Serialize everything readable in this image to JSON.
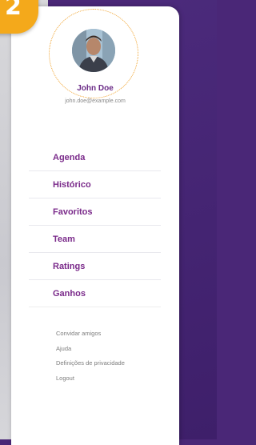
{
  "step": {
    "number": "2",
    "color": "#f4a91b"
  },
  "profile": {
    "name": "John Doe",
    "email": "john.doe@example.com"
  },
  "menu": {
    "items": [
      {
        "label": "Agenda"
      },
      {
        "label": "Histórico"
      },
      {
        "label": "Favoritos"
      },
      {
        "label": "Team"
      },
      {
        "label": "Ratings"
      },
      {
        "label": "Ganhos"
      }
    ]
  },
  "secondary": {
    "items": [
      {
        "label": "Convidar amigos"
      },
      {
        "label": "Ajuda"
      },
      {
        "label": "Definições de privacidade"
      },
      {
        "label": "Logout"
      }
    ]
  },
  "colors": {
    "accent": "#7a2a8a",
    "background": "#4a2777",
    "ring": "#f0a12a"
  }
}
